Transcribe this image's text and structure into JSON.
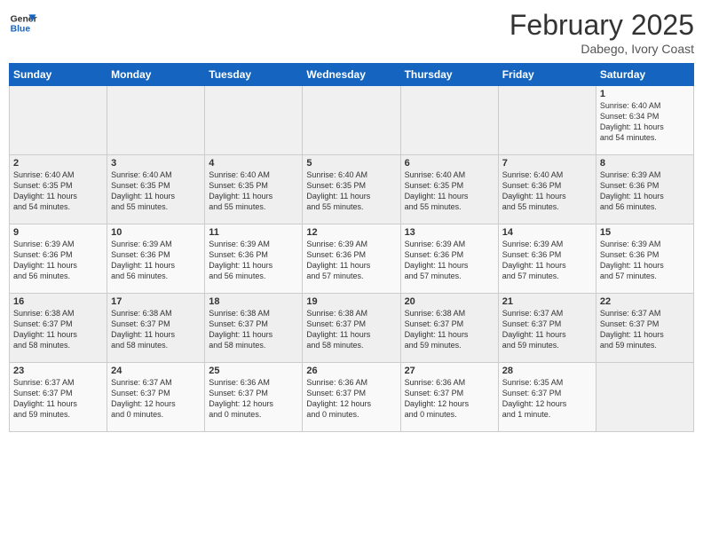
{
  "header": {
    "logo_line1": "General",
    "logo_line2": "Blue",
    "month": "February 2025",
    "location": "Dabego, Ivory Coast"
  },
  "days_of_week": [
    "Sunday",
    "Monday",
    "Tuesday",
    "Wednesday",
    "Thursday",
    "Friday",
    "Saturday"
  ],
  "weeks": [
    [
      {
        "day": "",
        "info": ""
      },
      {
        "day": "",
        "info": ""
      },
      {
        "day": "",
        "info": ""
      },
      {
        "day": "",
        "info": ""
      },
      {
        "day": "",
        "info": ""
      },
      {
        "day": "",
        "info": ""
      },
      {
        "day": "1",
        "info": "Sunrise: 6:40 AM\nSunset: 6:34 PM\nDaylight: 11 hours\nand 54 minutes."
      }
    ],
    [
      {
        "day": "2",
        "info": "Sunrise: 6:40 AM\nSunset: 6:35 PM\nDaylight: 11 hours\nand 54 minutes."
      },
      {
        "day": "3",
        "info": "Sunrise: 6:40 AM\nSunset: 6:35 PM\nDaylight: 11 hours\nand 55 minutes."
      },
      {
        "day": "4",
        "info": "Sunrise: 6:40 AM\nSunset: 6:35 PM\nDaylight: 11 hours\nand 55 minutes."
      },
      {
        "day": "5",
        "info": "Sunrise: 6:40 AM\nSunset: 6:35 PM\nDaylight: 11 hours\nand 55 minutes."
      },
      {
        "day": "6",
        "info": "Sunrise: 6:40 AM\nSunset: 6:35 PM\nDaylight: 11 hours\nand 55 minutes."
      },
      {
        "day": "7",
        "info": "Sunrise: 6:40 AM\nSunset: 6:36 PM\nDaylight: 11 hours\nand 55 minutes."
      },
      {
        "day": "8",
        "info": "Sunrise: 6:39 AM\nSunset: 6:36 PM\nDaylight: 11 hours\nand 56 minutes."
      }
    ],
    [
      {
        "day": "9",
        "info": "Sunrise: 6:39 AM\nSunset: 6:36 PM\nDaylight: 11 hours\nand 56 minutes."
      },
      {
        "day": "10",
        "info": "Sunrise: 6:39 AM\nSunset: 6:36 PM\nDaylight: 11 hours\nand 56 minutes."
      },
      {
        "day": "11",
        "info": "Sunrise: 6:39 AM\nSunset: 6:36 PM\nDaylight: 11 hours\nand 56 minutes."
      },
      {
        "day": "12",
        "info": "Sunrise: 6:39 AM\nSunset: 6:36 PM\nDaylight: 11 hours\nand 57 minutes."
      },
      {
        "day": "13",
        "info": "Sunrise: 6:39 AM\nSunset: 6:36 PM\nDaylight: 11 hours\nand 57 minutes."
      },
      {
        "day": "14",
        "info": "Sunrise: 6:39 AM\nSunset: 6:36 PM\nDaylight: 11 hours\nand 57 minutes."
      },
      {
        "day": "15",
        "info": "Sunrise: 6:39 AM\nSunset: 6:36 PM\nDaylight: 11 hours\nand 57 minutes."
      }
    ],
    [
      {
        "day": "16",
        "info": "Sunrise: 6:38 AM\nSunset: 6:37 PM\nDaylight: 11 hours\nand 58 minutes."
      },
      {
        "day": "17",
        "info": "Sunrise: 6:38 AM\nSunset: 6:37 PM\nDaylight: 11 hours\nand 58 minutes."
      },
      {
        "day": "18",
        "info": "Sunrise: 6:38 AM\nSunset: 6:37 PM\nDaylight: 11 hours\nand 58 minutes."
      },
      {
        "day": "19",
        "info": "Sunrise: 6:38 AM\nSunset: 6:37 PM\nDaylight: 11 hours\nand 58 minutes."
      },
      {
        "day": "20",
        "info": "Sunrise: 6:38 AM\nSunset: 6:37 PM\nDaylight: 11 hours\nand 59 minutes."
      },
      {
        "day": "21",
        "info": "Sunrise: 6:37 AM\nSunset: 6:37 PM\nDaylight: 11 hours\nand 59 minutes."
      },
      {
        "day": "22",
        "info": "Sunrise: 6:37 AM\nSunset: 6:37 PM\nDaylight: 11 hours\nand 59 minutes."
      }
    ],
    [
      {
        "day": "23",
        "info": "Sunrise: 6:37 AM\nSunset: 6:37 PM\nDaylight: 11 hours\nand 59 minutes."
      },
      {
        "day": "24",
        "info": "Sunrise: 6:37 AM\nSunset: 6:37 PM\nDaylight: 12 hours\nand 0 minutes."
      },
      {
        "day": "25",
        "info": "Sunrise: 6:36 AM\nSunset: 6:37 PM\nDaylight: 12 hours\nand 0 minutes."
      },
      {
        "day": "26",
        "info": "Sunrise: 6:36 AM\nSunset: 6:37 PM\nDaylight: 12 hours\nand 0 minutes."
      },
      {
        "day": "27",
        "info": "Sunrise: 6:36 AM\nSunset: 6:37 PM\nDaylight: 12 hours\nand 0 minutes."
      },
      {
        "day": "28",
        "info": "Sunrise: 6:35 AM\nSunset: 6:37 PM\nDaylight: 12 hours\nand 1 minute."
      },
      {
        "day": "",
        "info": ""
      }
    ]
  ]
}
